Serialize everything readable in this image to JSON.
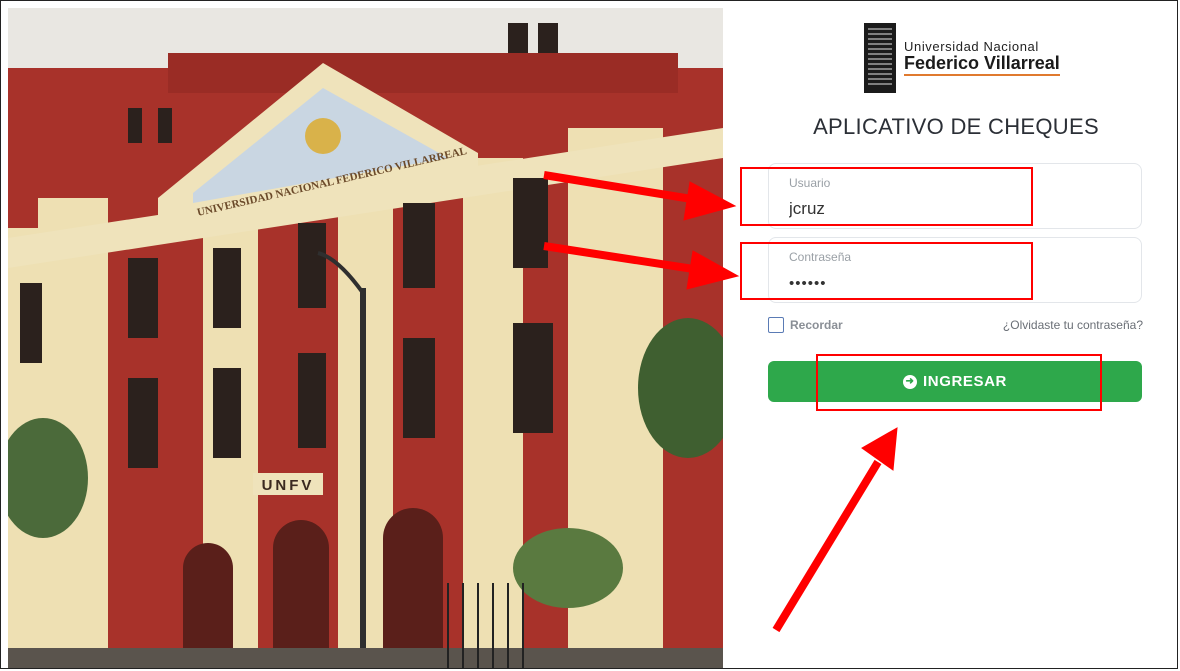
{
  "photo": {
    "pediment_text": "UNIVERSIDAD NACIONAL FEDERICO VILLARREAL",
    "entrance_sign": "UNFV"
  },
  "logo": {
    "line1": "Universidad Nacional",
    "line2": "Federico Villarreal"
  },
  "app_title": "APLICATIVO DE CHEQUES",
  "form": {
    "username_label": "Usuario",
    "username_value": "jcruz",
    "password_label": "Contraseña",
    "password_value": "••••••",
    "remember_label": "Recordar",
    "forgot_link": "¿Olvidaste tu contraseña?",
    "submit_label": "INGRESAR",
    "submit_icon": "arrow-circle-right-icon"
  },
  "colors": {
    "primary_button": "#2ea84b",
    "annotation": "#ff0000",
    "logo_underline": "#e07a2f"
  }
}
